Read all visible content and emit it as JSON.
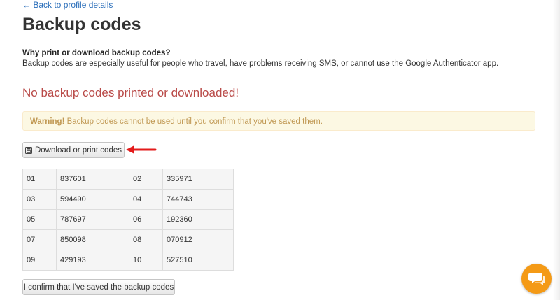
{
  "nav": {
    "back_link": "← Back to profile details"
  },
  "page": {
    "title": "Backup codes"
  },
  "info": {
    "heading": "Why print or download backup codes?",
    "text": "Backup codes are especially useful for people who travel, have problems receiving SMS, or cannot use the Google Authenticator app."
  },
  "status": {
    "message": "No backup codes printed or downloaded!"
  },
  "warning": {
    "label": "Warning!",
    "text": " Backup codes cannot be used until you confirm that you've saved them."
  },
  "actions": {
    "download_label": "Download or print codes",
    "confirm_label": "I confirm that I've saved the backup codes"
  },
  "codes": [
    {
      "n1": "01",
      "c1": "837601",
      "n2": "02",
      "c2": "335971"
    },
    {
      "n1": "03",
      "c1": "594490",
      "n2": "04",
      "c2": "744743"
    },
    {
      "n1": "05",
      "c1": "787697",
      "n2": "06",
      "c2": "192360"
    },
    {
      "n1": "07",
      "c1": "850098",
      "n2": "08",
      "c2": "070912"
    },
    {
      "n1": "09",
      "c1": "429193",
      "n2": "10",
      "c2": "527510"
    }
  ],
  "icons": {
    "download": "floppy-disk-icon",
    "annotation": "red-arrow-icon",
    "chat": "chat-bubble-icon"
  },
  "colors": {
    "link": "#2a6eba",
    "danger_text": "#b94a48",
    "warning_bg": "#fcf8e3",
    "warning_text": "#c09853",
    "annotation_arrow": "#e31b1b",
    "chat_button": "#f49a16"
  }
}
